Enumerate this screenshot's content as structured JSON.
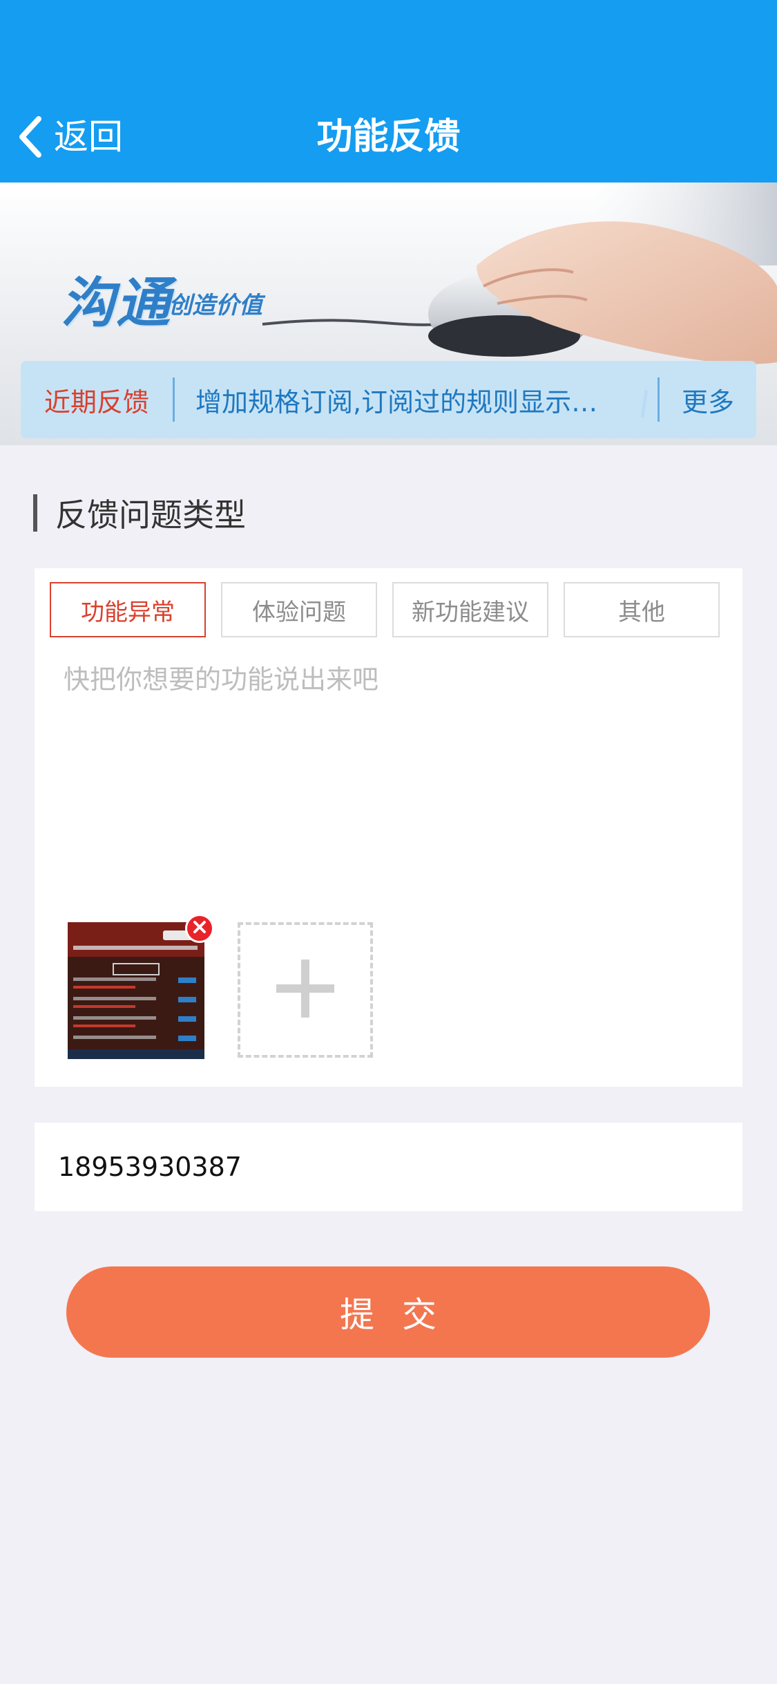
{
  "header": {
    "back_label": "返回",
    "title": "功能反馈",
    "background": "#149df1"
  },
  "banner": {
    "word": "沟通",
    "slogan": "创造价值"
  },
  "recent": {
    "label": "近期反馈",
    "text": "增加规格订阅,订阅过的规则显示…",
    "more_label": "更多"
  },
  "section": {
    "title": "反馈问题类型"
  },
  "types": [
    {
      "label": "功能异常",
      "active": true
    },
    {
      "label": "体验问题",
      "active": false
    },
    {
      "label": "新功能建议",
      "active": false
    },
    {
      "label": "其他",
      "active": false
    }
  ],
  "feedback": {
    "placeholder": "快把你想要的功能说出来吧",
    "value": ""
  },
  "attachments": {
    "count": 1
  },
  "phone": {
    "value": "18953930387"
  },
  "submit": {
    "label": "提交",
    "color": "#f4764f"
  },
  "icons": {
    "back": "chevron-left-icon",
    "remove": "close-icon",
    "add": "plus-icon"
  }
}
